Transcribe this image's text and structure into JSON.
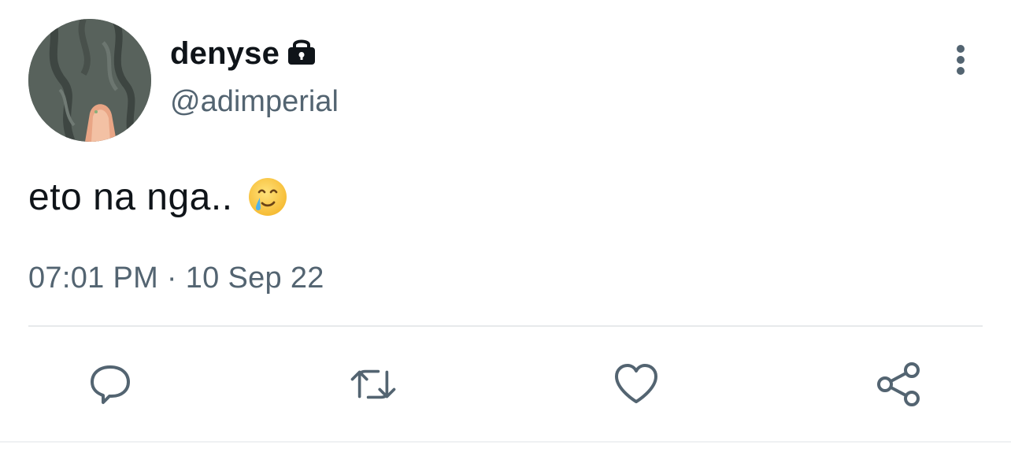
{
  "author": {
    "display_name": "denyse",
    "handle": "@adimperial",
    "protected": true
  },
  "tweet": {
    "text": "eto na nga..",
    "emoji": "smiling-face-with-tear",
    "timestamp": "07:01 PM · 10 Sep 22"
  },
  "actions": [
    "reply",
    "retweet",
    "like",
    "share"
  ],
  "colors": {
    "text_primary": "#0f1419",
    "text_secondary": "#536471",
    "icon": "#536471",
    "divider": "#e7e9eb"
  }
}
